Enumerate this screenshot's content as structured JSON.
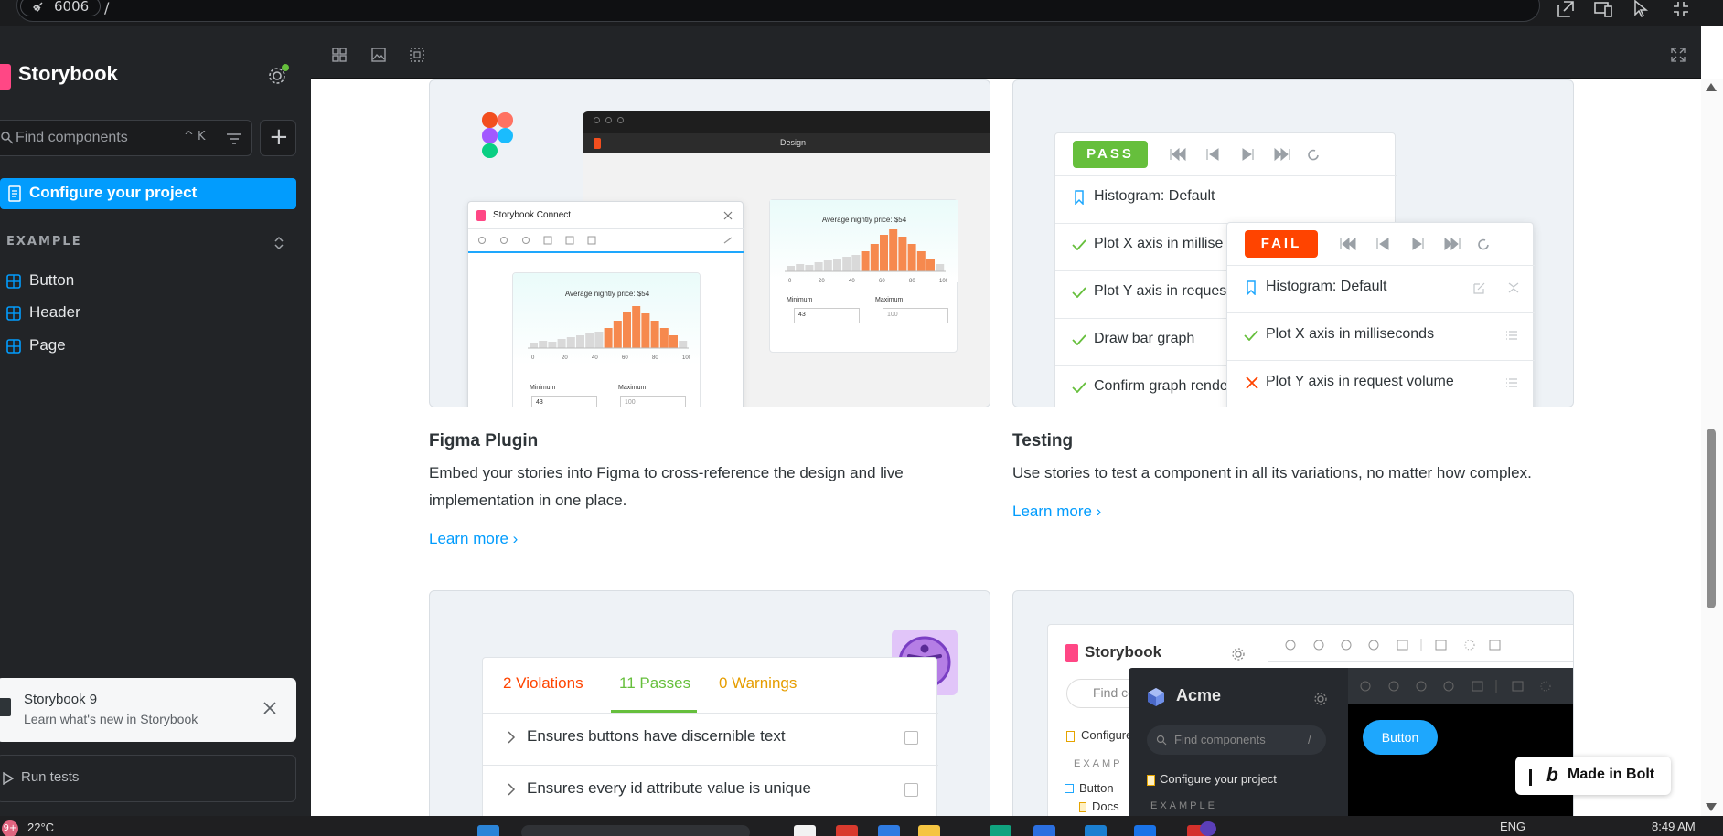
{
  "browser": {
    "port": "6006",
    "path": "/"
  },
  "sidebar": {
    "brand": "Storybook",
    "search_placeholder": "Find components",
    "search_shortcut": "^ K",
    "configure": "Configure your project",
    "section": "EXAMPLE",
    "items": [
      {
        "label": "Button"
      },
      {
        "label": "Header"
      },
      {
        "label": "Page"
      }
    ],
    "notice": {
      "title": "Storybook 9",
      "subtitle": "Learn what's new in Storybook"
    },
    "run_tests": "Run tests"
  },
  "cards": {
    "figma": {
      "title": "Figma Plugin",
      "desc_line1": "Embed your stories into Figma to cross-reference the design and live",
      "desc_line2": "implementation in one place.",
      "learn": "Learn more ›",
      "mock": {
        "window_title": "Design",
        "connect_title": "Storybook Connect",
        "chart_title": "Average nightly price: $54",
        "min_label": "Minimum",
        "max_label": "Maximum",
        "min_value": "43",
        "max_value": "100",
        "ticks": [
          "0",
          "20",
          "40",
          "60",
          "80",
          "100"
        ]
      }
    },
    "testing": {
      "title": "Testing",
      "desc": "Use stories to test a component in all its variations, no matter how complex.",
      "learn": "Learn more ›",
      "mock": {
        "pass": "PASS",
        "fail": "FAIL",
        "back_items": [
          "Histogram: Default",
          "Plot X axis in millise",
          "Plot Y axis in reques",
          "Draw bar graph",
          "Confirm graph rende"
        ],
        "front_items": [
          "Histogram: Default",
          "Plot X axis in milliseconds",
          "Plot Y axis in request volume"
        ]
      }
    },
    "a11y": {
      "violations": "2 Violations",
      "passes": "11 Passes",
      "warnings": "0 Warnings",
      "rules": [
        "Ensures buttons have discernible text",
        "Ensures every id attribute value is unique"
      ]
    },
    "theme": {
      "sb_brand": "Storybook",
      "acme_brand": "Acme",
      "find_placeholder": "Find components",
      "find_short": "Find co",
      "slash": "/",
      "configure": "Configure your project",
      "configure_short": "Configure",
      "example": "EXAMPLE",
      "example_short": "EXAMP",
      "button_item": "Button",
      "docs_item": "Docs",
      "preview_button": "Button"
    }
  },
  "badge": {
    "bolt_label": "Made in Bolt"
  },
  "taskbar": {
    "notif": "9+",
    "temp": "22°C",
    "lang": "ENG",
    "time": "8:49 AM"
  },
  "colors": {
    "accent": "#029cfd",
    "pink": "#ff4785",
    "pass": "#66bf3c",
    "fail": "#ff4400",
    "warning": "#e69d00",
    "sidebar_bg": "#222427"
  }
}
